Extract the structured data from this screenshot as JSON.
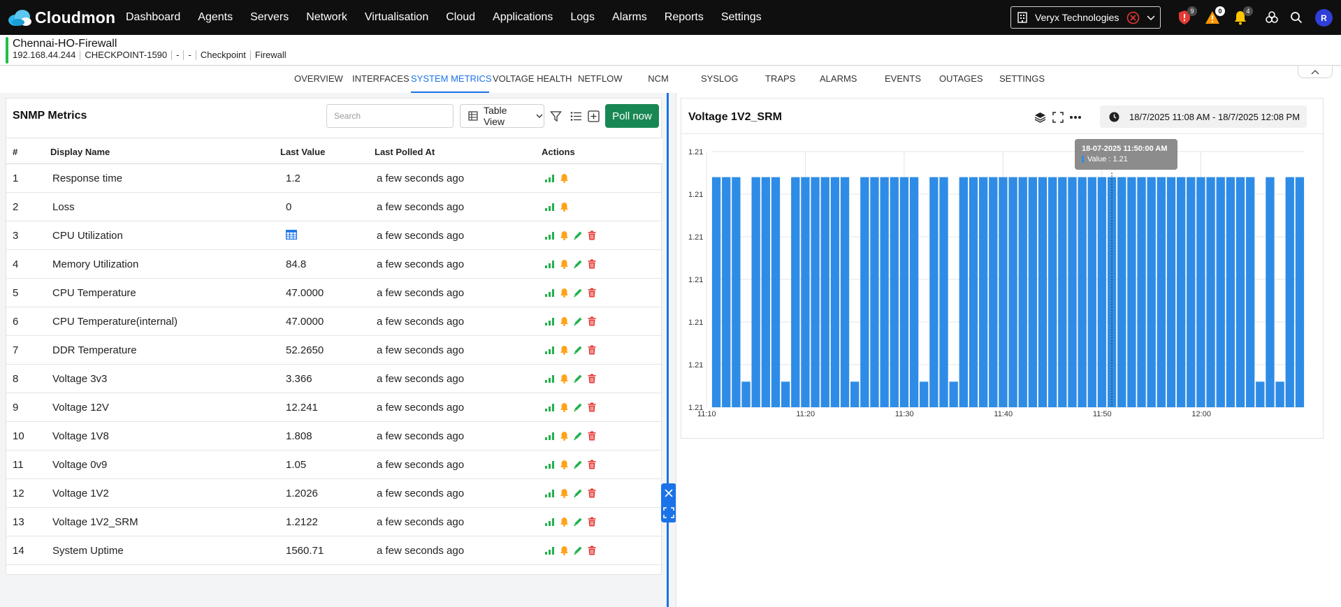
{
  "app": {
    "brand": "Cloudmon"
  },
  "nav": {
    "items": [
      "Dashboard",
      "Agents",
      "Servers",
      "Network",
      "Virtualisation",
      "Cloud",
      "Applications",
      "Logs",
      "Alarms",
      "Reports",
      "Settings"
    ]
  },
  "topbar": {
    "org": "Veryx Technologies",
    "shield_badge": "9",
    "warning_badge": "0",
    "bell_badge": "4",
    "avatar": "R"
  },
  "device": {
    "name": "Chennai-HO-Firewall",
    "ip": "192.168.44.244",
    "model": "CHECKPOINT-1590",
    "meta1": "-",
    "meta2": "-",
    "vendor": "Checkpoint",
    "type": "Firewall"
  },
  "tabs": [
    "OVERVIEW",
    "INTERFACES",
    "SYSTEM METRICS",
    "VOLTAGE HEALTH",
    "NETFLOW",
    "NCM",
    "SYSLOG",
    "TRAPS",
    "ALARMS",
    "EVENTS",
    "OUTAGES",
    "SETTINGS"
  ],
  "active_tab": "SYSTEM METRICS",
  "snmp": {
    "title": "SNMP Metrics",
    "search_placeholder": "Search",
    "view_label": "Table View",
    "poll_label": "Poll now",
    "columns": [
      "#",
      "Display Name",
      "Last Value",
      "Last Polled At",
      "Actions"
    ],
    "rows": [
      {
        "num": "1",
        "name": "Response time",
        "value": "1.2",
        "polled": "a few seconds ago",
        "editable": false
      },
      {
        "num": "2",
        "name": "Loss",
        "value": "0",
        "polled": "a few seconds ago",
        "editable": false
      },
      {
        "num": "3",
        "name": "CPU Utilization",
        "value": "",
        "value_icon": "table-icon",
        "polled": "a few seconds ago",
        "editable": true
      },
      {
        "num": "4",
        "name": "Memory Utilization",
        "value": "84.8",
        "polled": "a few seconds ago",
        "editable": true
      },
      {
        "num": "5",
        "name": "CPU Temperature",
        "value": "47.0000",
        "polled": "a few seconds ago",
        "editable": true
      },
      {
        "num": "6",
        "name": "CPU Temperature(internal)",
        "value": "47.0000",
        "polled": "a few seconds ago",
        "editable": true
      },
      {
        "num": "7",
        "name": "DDR Temperature",
        "value": "52.2650",
        "polled": "a few seconds ago",
        "editable": true
      },
      {
        "num": "8",
        "name": "Voltage 3v3",
        "value": "3.366",
        "polled": "a few seconds ago",
        "editable": true
      },
      {
        "num": "9",
        "name": "Voltage 12V",
        "value": "12.241",
        "polled": "a few seconds ago",
        "editable": true
      },
      {
        "num": "10",
        "name": "Voltage 1V8",
        "value": "1.808",
        "polled": "a few seconds ago",
        "editable": true
      },
      {
        "num": "11",
        "name": "Voltage 0v9",
        "value": "1.05",
        "polled": "a few seconds ago",
        "editable": true
      },
      {
        "num": "12",
        "name": "Voltage 1V2",
        "value": "1.2026",
        "polled": "a few seconds ago",
        "editable": true
      },
      {
        "num": "13",
        "name": "Voltage 1V2_SRM",
        "value": "1.2122",
        "polled": "a few seconds ago",
        "editable": true
      },
      {
        "num": "14",
        "name": "System Uptime",
        "value": "1560.71",
        "polled": "a few seconds ago",
        "editable": true
      }
    ]
  },
  "chart_panel": {
    "title": "Voltage 1V2_SRM",
    "date_range": "18/7/2025 11:08 AM - 18/7/2025 12:08 PM",
    "tooltip_title": "18-07-2025 11:50:00 AM",
    "tooltip_value": "Value : 1.21"
  },
  "chart_data": {
    "type": "bar",
    "y_tick_labels": [
      "1.21",
      "1.21",
      "1.21",
      "1.21",
      "1.21",
      "1.21",
      "1.21"
    ],
    "x_tick_labels": [
      "11:10",
      "11:20",
      "11:30",
      "11:40",
      "11:50",
      "12:00"
    ],
    "x_range_minutes": [
      11.0,
      71.0
    ],
    "level_scale": [
      0,
      6
    ],
    "bar_color": "#2f8ce6",
    "grid": true,
    "bars": [
      {
        "t": 11.0,
        "v": 5.4
      },
      {
        "t": 12.0,
        "v": 5.4
      },
      {
        "t": 13.0,
        "v": 5.4
      },
      {
        "t": 14.0,
        "v": 0.6
      },
      {
        "t": 15.0,
        "v": 5.4
      },
      {
        "t": 16.0,
        "v": 5.4
      },
      {
        "t": 17.0,
        "v": 5.4
      },
      {
        "t": 18.0,
        "v": 0.6
      },
      {
        "t": 19.0,
        "v": 5.4
      },
      {
        "t": 20.0,
        "v": 5.4
      },
      {
        "t": 21.0,
        "v": 5.4
      },
      {
        "t": 22.0,
        "v": 5.4
      },
      {
        "t": 23.0,
        "v": 5.4
      },
      {
        "t": 24.0,
        "v": 5.4
      },
      {
        "t": 25.0,
        "v": 0.6
      },
      {
        "t": 26.0,
        "v": 5.4
      },
      {
        "t": 27.0,
        "v": 5.4
      },
      {
        "t": 28.0,
        "v": 5.4
      },
      {
        "t": 29.0,
        "v": 5.4
      },
      {
        "t": 30.0,
        "v": 5.4
      },
      {
        "t": 31.0,
        "v": 5.4
      },
      {
        "t": 32.0,
        "v": 0.6
      },
      {
        "t": 33.0,
        "v": 5.4
      },
      {
        "t": 34.0,
        "v": 5.4
      },
      {
        "t": 35.0,
        "v": 0.6
      },
      {
        "t": 36.0,
        "v": 5.4
      },
      {
        "t": 37.0,
        "v": 5.4
      },
      {
        "t": 38.0,
        "v": 5.4
      },
      {
        "t": 39.0,
        "v": 5.4
      },
      {
        "t": 40.0,
        "v": 5.4
      },
      {
        "t": 41.0,
        "v": 5.4
      },
      {
        "t": 42.0,
        "v": 5.4
      },
      {
        "t": 43.0,
        "v": 5.4
      },
      {
        "t": 44.0,
        "v": 5.4
      },
      {
        "t": 45.0,
        "v": 5.4
      },
      {
        "t": 46.0,
        "v": 5.4
      },
      {
        "t": 47.0,
        "v": 5.4
      },
      {
        "t": 48.0,
        "v": 5.4
      },
      {
        "t": 49.0,
        "v": 5.4
      },
      {
        "t": 50.0,
        "v": 5.4
      },
      {
        "t": 51.0,
        "v": 5.4
      },
      {
        "t": 52.0,
        "v": 5.4
      },
      {
        "t": 53.0,
        "v": 5.4
      },
      {
        "t": 54.0,
        "v": 5.4
      },
      {
        "t": 55.0,
        "v": 5.4
      },
      {
        "t": 56.0,
        "v": 5.4
      },
      {
        "t": 57.0,
        "v": 5.4
      },
      {
        "t": 58.0,
        "v": 5.4
      },
      {
        "t": 59.0,
        "v": 5.4
      },
      {
        "t": 60.0,
        "v": 5.4
      },
      {
        "t": 61.0,
        "v": 5.4
      },
      {
        "t": 62.0,
        "v": 5.4
      },
      {
        "t": 63.0,
        "v": 5.4
      },
      {
        "t": 64.0,
        "v": 5.4
      },
      {
        "t": 65.0,
        "v": 5.4
      },
      {
        "t": 66.0,
        "v": 0.6
      },
      {
        "t": 67.0,
        "v": 5.4
      },
      {
        "t": 68.0,
        "v": 0.6
      },
      {
        "t": 69.0,
        "v": 5.4
      },
      {
        "t": 70.0,
        "v": 5.4
      }
    ],
    "cursor_t": 51.0
  }
}
